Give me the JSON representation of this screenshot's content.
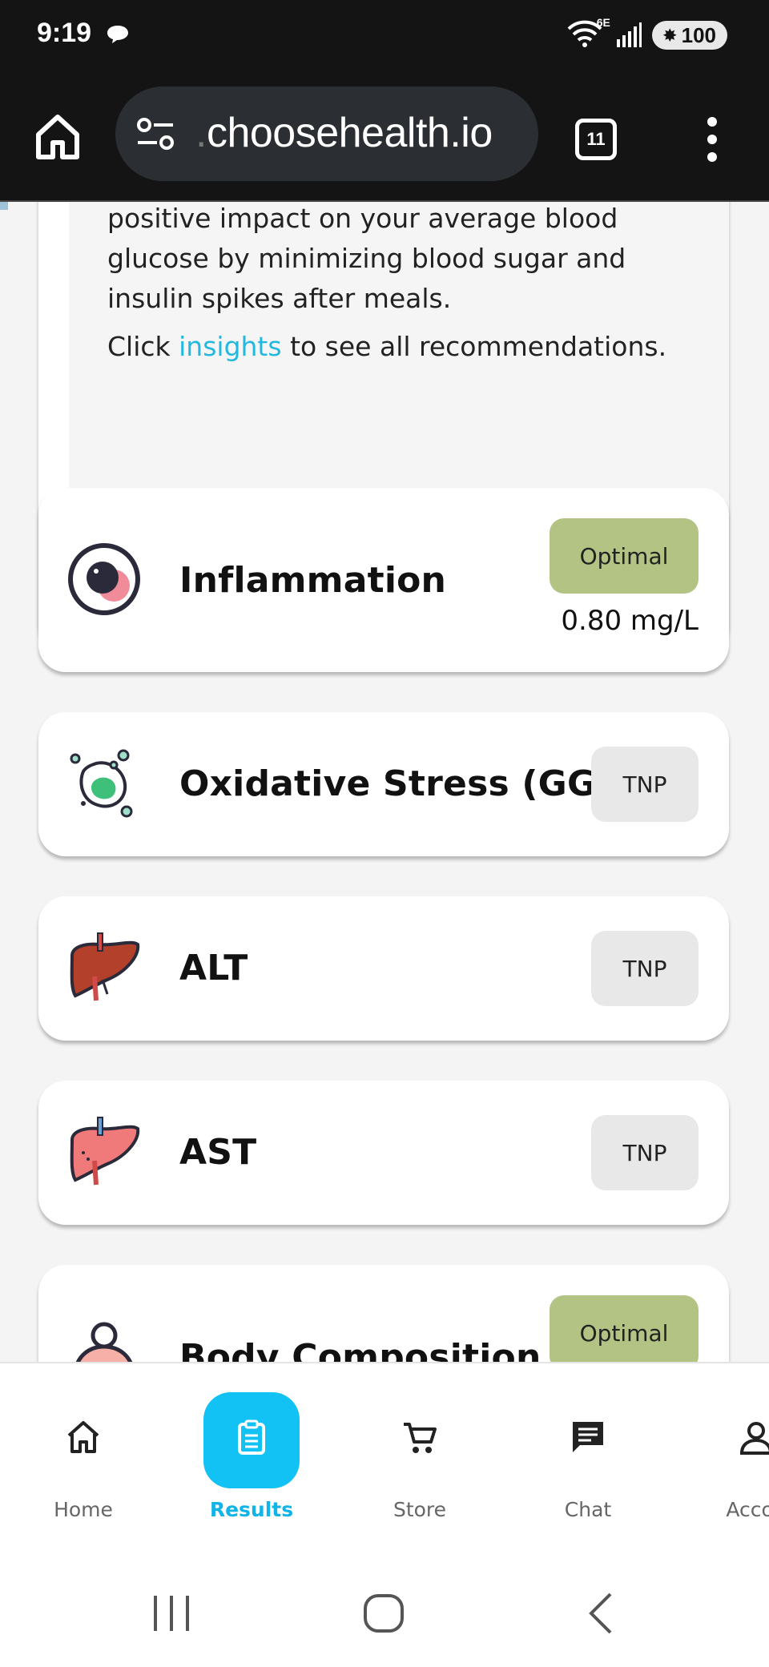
{
  "status_bar": {
    "time": "9:19",
    "network_label": "6E",
    "battery": "100"
  },
  "browser": {
    "url_prefix": ".",
    "url_host": "choosehealth.io",
    "tab_count": "11"
  },
  "summary": {
    "paragraph_1": "positive impact on your average blood glucose by minimizing blood sugar and insulin spikes after meals.",
    "click_prefix": "Click ",
    "link_text": "insights",
    "click_suffix": " to see all recommendations."
  },
  "markers": [
    {
      "name": "Inflammation",
      "badge": "Optimal",
      "value": "0.80 mg/L"
    },
    {
      "name": "Oxidative Stress (GGT)",
      "badge": "TNP"
    },
    {
      "name": "ALT",
      "badge": "TNP"
    },
    {
      "name": "AST",
      "badge": "TNP"
    },
    {
      "name": "Body Composition",
      "badge": "Optimal"
    }
  ],
  "bottom_nav": {
    "items": [
      {
        "label": "Home",
        "icon": "home-icon"
      },
      {
        "label": "Results",
        "icon": "clipboard-icon",
        "active": true
      },
      {
        "label": "Store",
        "icon": "cart-icon"
      },
      {
        "label": "Chat",
        "icon": "chat-icon"
      },
      {
        "label": "Accou",
        "icon": "account-icon"
      }
    ]
  },
  "colors": {
    "accent": "#12c2f4",
    "optimal_badge": "#b2c384",
    "tnp_badge": "#e8e8e8",
    "link": "#22b8e0"
  }
}
